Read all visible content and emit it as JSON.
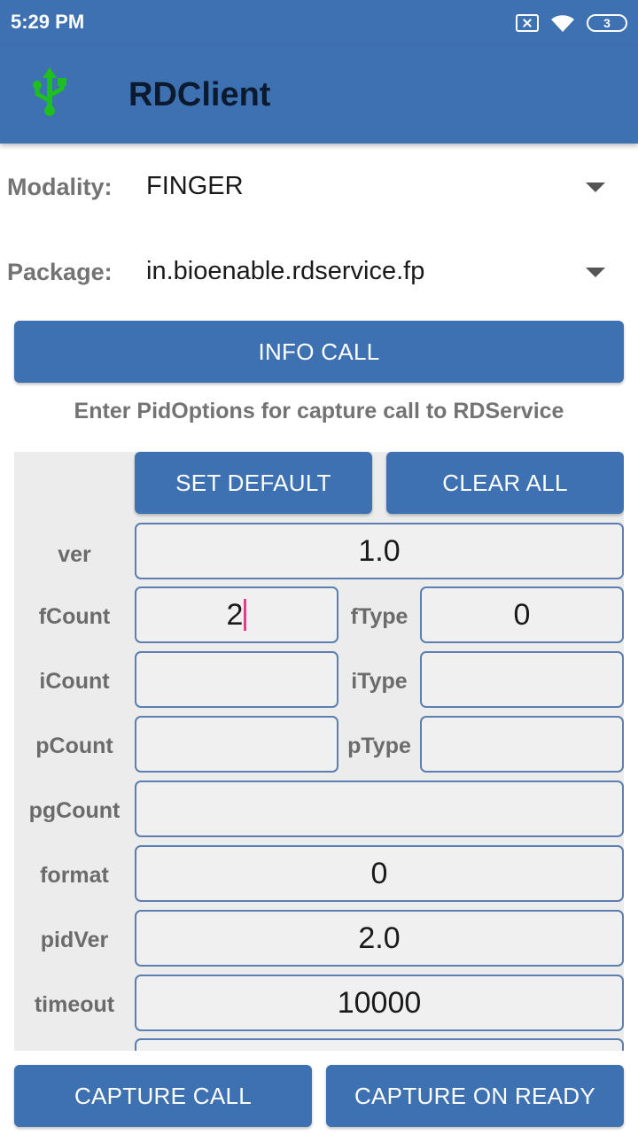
{
  "status_bar": {
    "time": "5:29 PM",
    "battery": "3",
    "icons": [
      "sim-icon",
      "wifi-icon",
      "battery-icon"
    ]
  },
  "app": {
    "title": "RDClient",
    "icon": "usb-icon",
    "icon_color": "#1fbf1f",
    "bar_color": "#3d71b1"
  },
  "modality": {
    "label": "Modality:",
    "value": "FINGER"
  },
  "package": {
    "label": "Package:",
    "value": "in.bioenable.rdservice.fp"
  },
  "buttons": {
    "info_call": "INFO CALL",
    "set_default": "SET DEFAULT",
    "clear_all": "CLEAR ALL",
    "capture_call": "CAPTURE CALL",
    "capture_on_ready": "CAPTURE ON READY"
  },
  "hint": "Enter PidOptions for capture call to RDService",
  "fields": {
    "ver": {
      "label": "ver",
      "value": "1.0"
    },
    "fCount": {
      "label": "fCount",
      "value": "2"
    },
    "fType": {
      "label": "fType",
      "value": "0"
    },
    "iCount": {
      "label": "iCount",
      "value": ""
    },
    "iType": {
      "label": "iType",
      "value": ""
    },
    "pCount": {
      "label": "pCount",
      "value": ""
    },
    "pType": {
      "label": "pType",
      "value": ""
    },
    "pgCount": {
      "label": "pgCount",
      "value": ""
    },
    "format": {
      "label": "format",
      "value": "0"
    },
    "pidVer": {
      "label": "pidVer",
      "value": "2.0"
    },
    "timeout": {
      "label": "timeout",
      "value": "10000"
    }
  }
}
